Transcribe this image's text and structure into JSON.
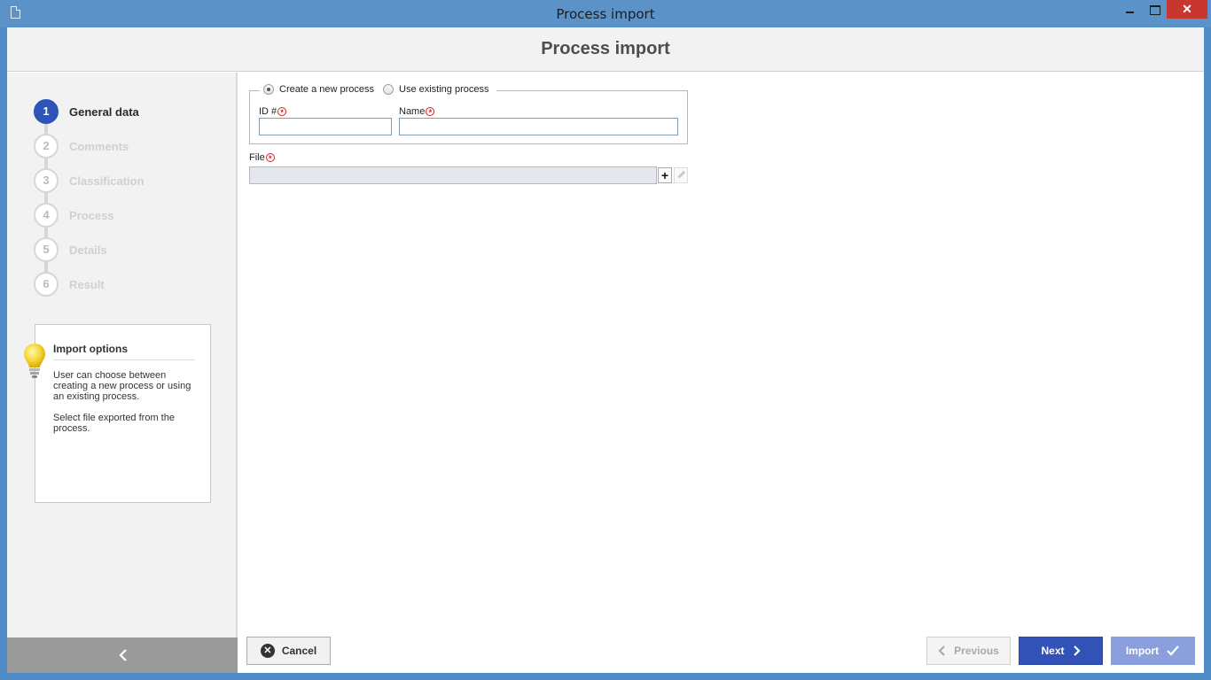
{
  "window": {
    "title": "Process import",
    "controls": {
      "minimize": "minimize-icon",
      "maximize": "maximize-icon",
      "close": "close-icon",
      "close_glyph": "✕"
    }
  },
  "header": {
    "title": "Process import"
  },
  "steps": [
    {
      "num": "1",
      "label": "General data",
      "active": true
    },
    {
      "num": "2",
      "label": "Comments",
      "active": false
    },
    {
      "num": "3",
      "label": "Classification",
      "active": false
    },
    {
      "num": "4",
      "label": "Process",
      "active": false
    },
    {
      "num": "5",
      "label": "Details",
      "active": false
    },
    {
      "num": "6",
      "label": "Result",
      "active": false
    }
  ],
  "info": {
    "icon": "lightbulb-icon",
    "title": "Import options",
    "paragraph1": "User can choose between creating a new process or using an existing process.",
    "paragraph2": "Select file exported from the process."
  },
  "form": {
    "option_new": "Create a new process",
    "option_existing": "Use existing process",
    "selected_option": "Create a new process",
    "id_label": "ID #",
    "id_value": "",
    "name_label": "Name",
    "name_value": "",
    "file_label": "File",
    "file_value": "",
    "required_icon": "required-icon",
    "add_glyph": "+",
    "clear_icon": "eraser-icon"
  },
  "buttons": {
    "cancel": "Cancel",
    "previous": "Previous",
    "next": "Next",
    "import": "Import"
  },
  "colors": {
    "accent": "#2f54b7",
    "titlebar": "#5b93c9",
    "close": "#c7372f",
    "import_disabled": "#8aa0dd"
  }
}
